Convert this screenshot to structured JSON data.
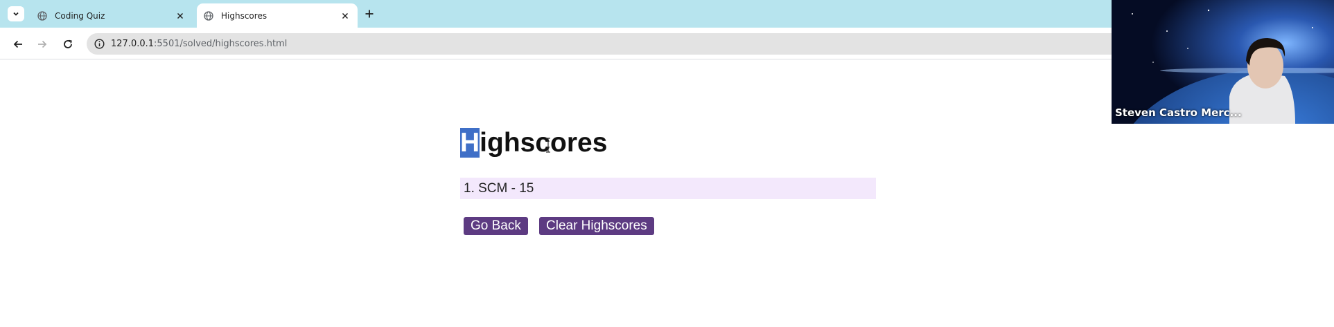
{
  "browser": {
    "tabs": [
      {
        "title": "Coding Quiz",
        "active": false
      },
      {
        "title": "Highscores",
        "active": true
      }
    ],
    "url_host": "127.0.0.1",
    "url_path": ":5501/solved/highscores.html"
  },
  "page": {
    "heading_first": "H",
    "heading_rest": "ighscores",
    "scores": [
      "1. SCM - 15"
    ],
    "go_back_label": "Go Back",
    "clear_label": "Clear Highscores"
  },
  "webcam": {
    "name": "Steven Castro Merc..."
  },
  "colors": {
    "tabstrip": "#b7e4ee",
    "button": "#5d3b82",
    "score_bg": "#f3e8fc",
    "selection": "#3f6fc7"
  }
}
